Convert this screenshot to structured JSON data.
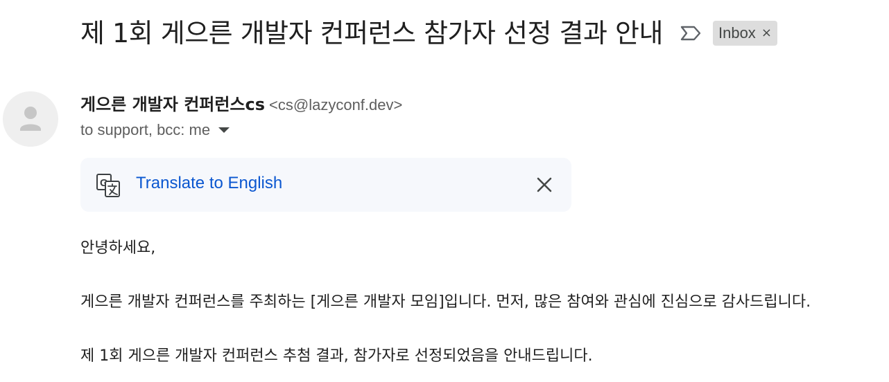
{
  "email": {
    "subject": "제 1회 게으른 개발자 컨퍼런스 참가자 선정 결과 안내",
    "important_icon": "label-important-outline-icon",
    "label_chip": {
      "text": "Inbox",
      "close_symbol": "×"
    },
    "sender": {
      "name": "게으른 개발자 컨퍼런스cs",
      "email": "<cs@lazyconf.dev>",
      "avatar_icon": "default-person-avatar-icon"
    },
    "recipients": "to support, bcc: me",
    "translate": {
      "icon": "google-translate-icon",
      "link_text": "Translate to English",
      "close_icon": "close-icon"
    },
    "body": {
      "greeting": "안녕하세요,",
      "paragraph_1": "게으른 개발자 컨퍼런스를 주최하는 [게으른 개발자 모임]입니다. 먼저, 많은 참여와 관심에 진심으로 감사드립니다.",
      "paragraph_2": "제 1회 게으른 개발자 컨퍼런스 추첨 결과, 참가자로 선정되었음을 안내드립니다."
    }
  },
  "colors": {
    "link_blue": "#0b57d0",
    "translate_bar_bg": "#f6f8fc",
    "chip_bg": "#dddddd",
    "secondary_text": "#5e5e5e",
    "primary_text": "#1f1f1f"
  }
}
